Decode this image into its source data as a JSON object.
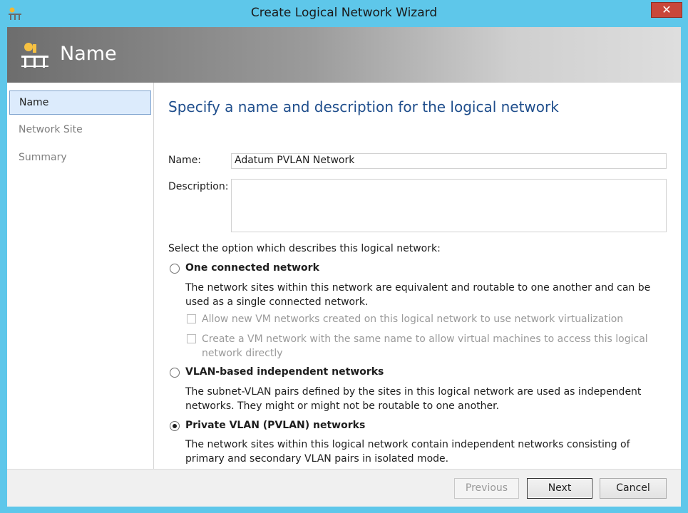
{
  "window": {
    "title": "Create Logical Network Wizard",
    "close_label": "✕"
  },
  "banner": {
    "title": "Name"
  },
  "sidebar": {
    "items": [
      {
        "label": "Name",
        "active": true
      },
      {
        "label": "Network Site",
        "active": false
      },
      {
        "label": "Summary",
        "active": false
      }
    ]
  },
  "main": {
    "heading": "Specify a name and description for the logical network",
    "name_label": "Name:",
    "name_value": "Adatum PVLAN Network",
    "description_label": "Description:",
    "description_value": "",
    "option_prompt": "Select the option which describes this logical network:",
    "options": [
      {
        "label": "One connected network",
        "selected": false,
        "description": "The network sites within this network are equivalent and routable to one another and can be used as a single connected network."
      },
      {
        "label": "VLAN-based independent networks",
        "selected": false,
        "description": "The subnet-VLAN pairs defined by the sites in this logical network are used as independent networks. They might or might not be routable to one another."
      },
      {
        "label": "Private VLAN (PVLAN) networks",
        "selected": true,
        "description": "The network sites within this logical network contain independent networks consisting of primary and secondary VLAN pairs in isolated mode."
      }
    ],
    "checkboxes": [
      {
        "label": "Allow new VM networks created on this logical network to use network virtualization",
        "checked": false,
        "enabled": false
      },
      {
        "label": "Create a VM network with the same name to allow virtual machines to access this logical network directly",
        "checked": false,
        "enabled": false
      }
    ]
  },
  "footer": {
    "previous_label": "Previous",
    "next_label": "Next",
    "cancel_label": "Cancel"
  },
  "colors": {
    "title_bar": "#5ec7ea",
    "heading": "#1f4e8c",
    "nav_active_bg": "#dcebfc",
    "close_button": "#c9473a"
  }
}
